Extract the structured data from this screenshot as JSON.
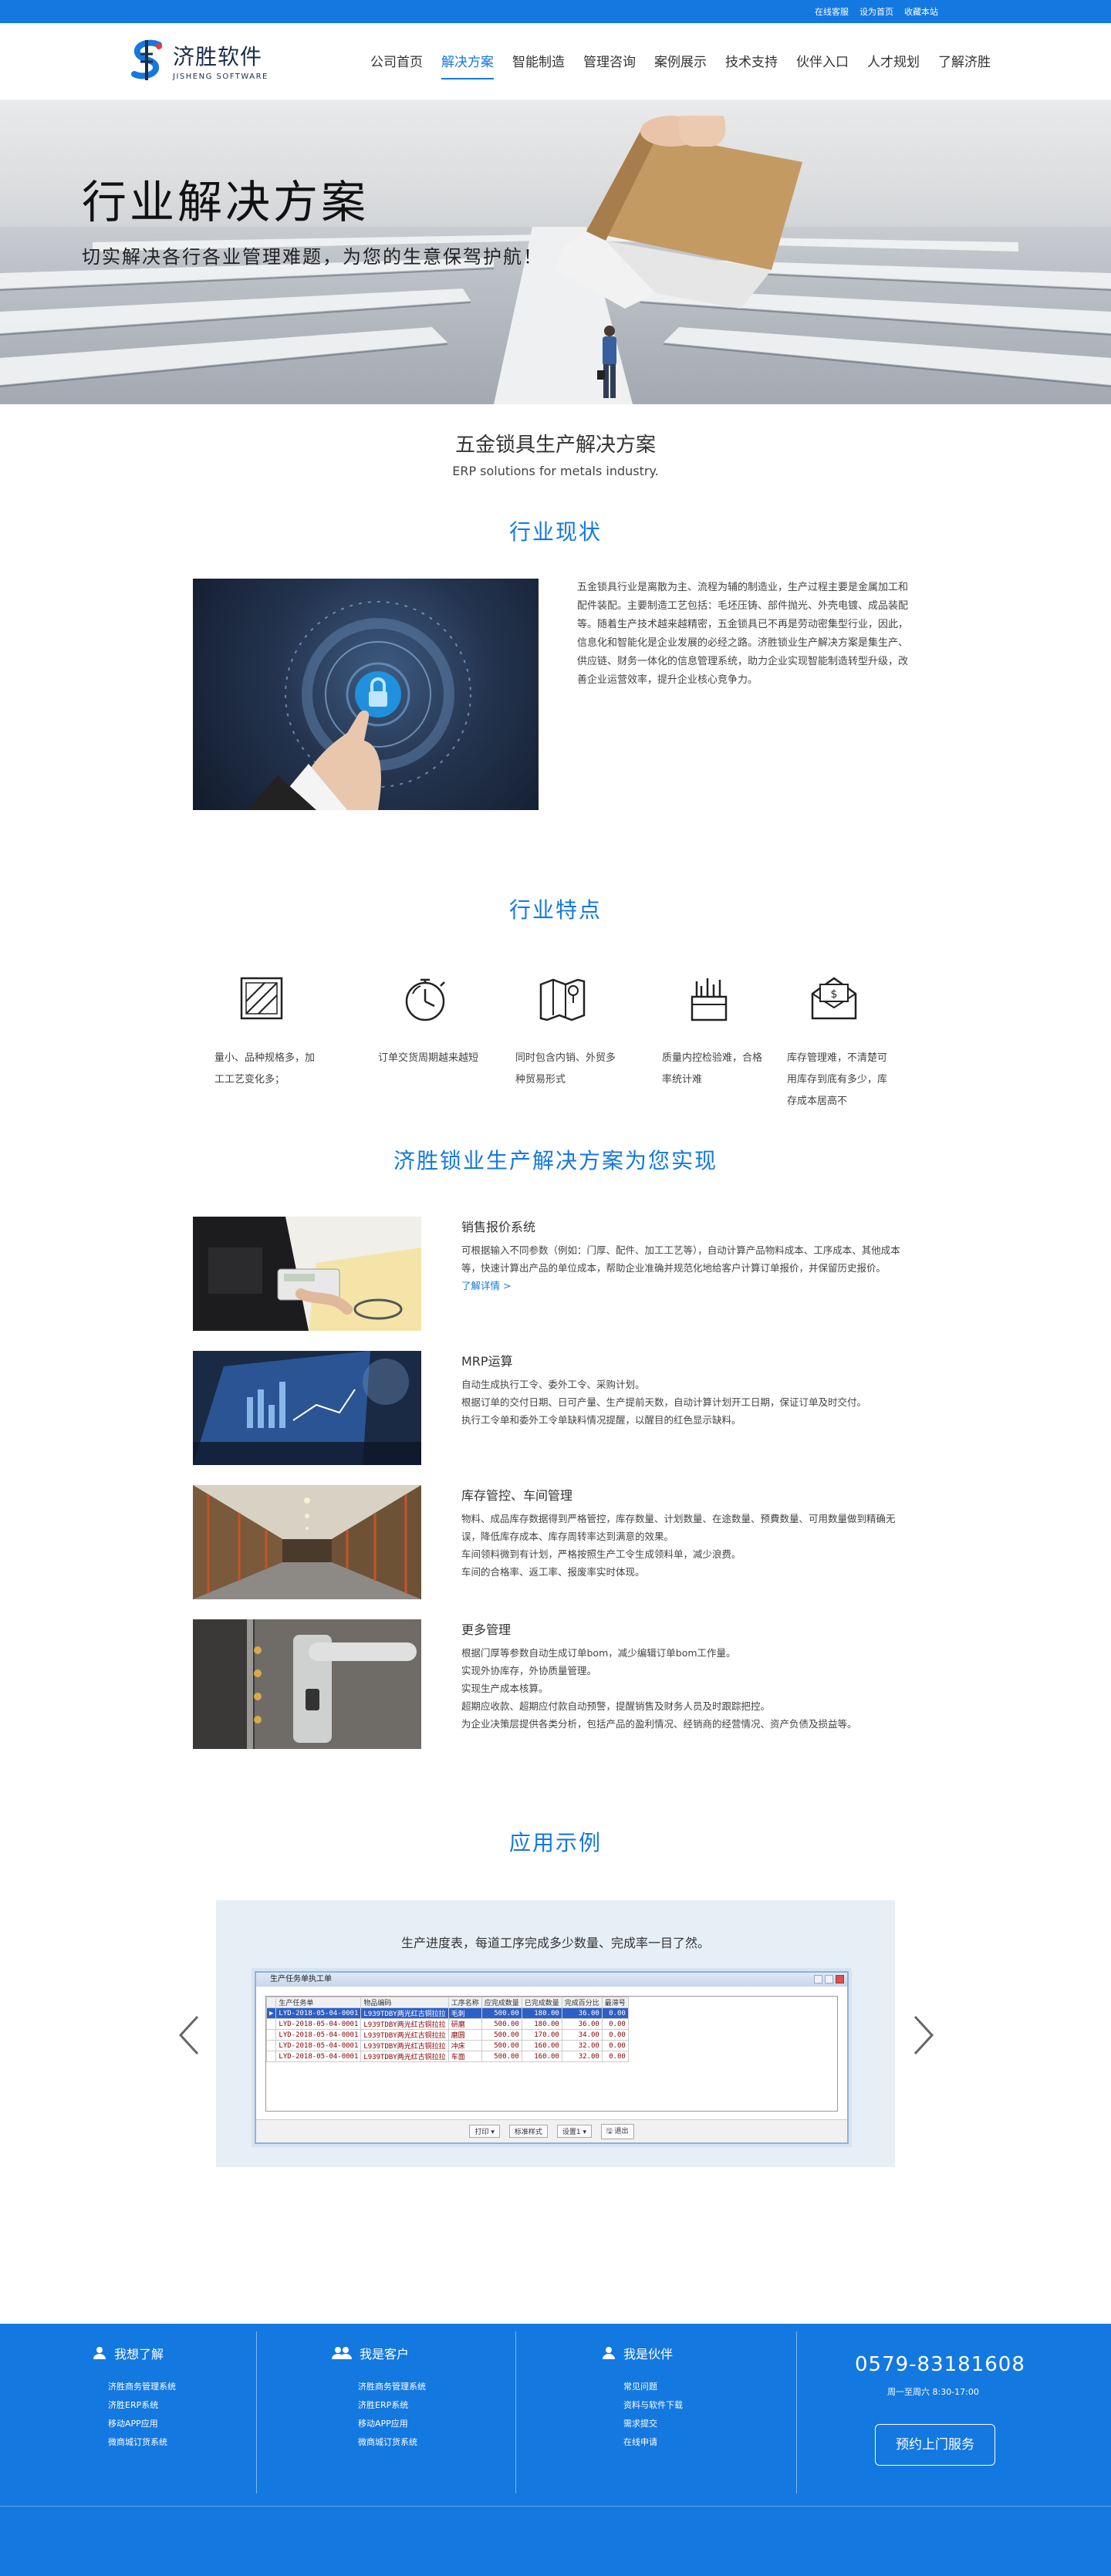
{
  "topbar": {
    "links": [
      "在线客服",
      "设为首页",
      "收藏本站"
    ]
  },
  "logo": {
    "cn": "济胜软件",
    "en": "JISHENG SOFTWARE"
  },
  "nav": [
    "公司首页",
    "解决方案",
    "智能制造",
    "管理咨询",
    "案例展示",
    "技术支持",
    "伙伴入口",
    "人才规划",
    "了解济胜"
  ],
  "banner": {
    "title": "行业解决方案",
    "subtitle": "切实解决各行各业管理难题，为您的生意保驾护航！"
  },
  "product": {
    "title": "五金锁具生产解决方案",
    "subtitle": "ERP solutions for metals industry."
  },
  "status": {
    "heading": "行业现状",
    "text": "五金锁具行业是离散为主、流程为辅的制造业，生产过程主要是金属加工和配件装配。主要制造工艺包括：毛坯压铸、部件抛光、外壳电镀、成品装配等。随着生产技术越来越精密，五金锁具已不再是劳动密集型行业，因此，信息化和智能化是企业发展的必经之路。济胜锁业生产解决方案是集生产、供应链、财务一体化的信息管理系统，助力企业实现智能制造转型升级，改善企业运营效率，提升企业核心竞争力。"
  },
  "features": {
    "heading": "行业特点",
    "items": [
      {
        "icon": "box-icon",
        "text": "量小、品种规格多，加工工艺变化多；"
      },
      {
        "icon": "stopwatch-icon",
        "text": "订单交货周期越来越短"
      },
      {
        "icon": "map-icon",
        "text": "同时包含内销、外贸多种贸易形式"
      },
      {
        "icon": "toolbox-icon",
        "text": "质量内控检验难，合格率统计难"
      },
      {
        "icon": "money-mail-icon",
        "text": "库存管理难，不清楚可用库存到底有多少，库存成本居高不"
      }
    ]
  },
  "solutions": {
    "heading": "济胜锁业生产解决方案为您实现",
    "items": [
      {
        "title": "销售报价系统",
        "lines": [
          "可根据输入不同参数（例如：门厚、配件、加工工艺等），自动计算产品物料成本、工序成本、其他成本等，快速计算出产品的单位成本，帮助企业准确并规范化地给客户计算订单报价，并保留历史报价。"
        ],
        "more": "了解详情 >"
      },
      {
        "title": "MRP运算",
        "lines": [
          "自动生成执行工令、委外工令、采购计划。",
          "根据订单的交付日期、日可产量、生产提前天数，自动计算计划开工日期，保证订单及时交付。",
          "执行工令单和委外工令单缺料情况提醒，以醒目的红色显示缺料。"
        ]
      },
      {
        "title": "库存管控、车间管理",
        "lines": [
          "物料、成品库存数据得到严格管控，库存数量、计划数量、在途数量、预費数量、可用数量做到精确无误，降低库存成本、库存周转率达到满意的效果。",
          "车间领料微到有计划，严格按照生产工令生成领料单，减少浪费。",
          "车间的合格率、返工率、报废率实时体现。"
        ]
      },
      {
        "title": "更多管理",
        "lines": [
          "根据门厚等参数自动生成订单bom，减少编辑订单bom工作量。",
          "实现外协库存，外协质量管理。",
          "实现生产成本核算。",
          "超期应收款、超期应付款自动预警，提醒销售及财务人员及时跟踪把控。",
          "为企业决策层提供各类分析，包括产品的盈利情况、经销商的经营情况、资产负债及损益等。"
        ]
      }
    ]
  },
  "example": {
    "heading": "应用示例",
    "caption": "生产进度表，每道工序完成多少数量、完成率一目了然。",
    "window_title": "生产任务单执工单",
    "columns": [
      "生产任务单",
      "物品编码",
      "工序名称",
      "应完成数量",
      "已完成数量",
      "完成百分比",
      "最滞号"
    ],
    "rows": [
      [
        "LYD-2018-05-04-0001",
        "L939TDBY两光红古铜拉拉",
        "毛刺",
        "500.00",
        "180.00",
        "36.00",
        "0.00"
      ],
      [
        "LYD-2018-05-04-0001",
        "L939TDBY两光红古铜拉拉",
        "研磨",
        "500.00",
        "180.00",
        "36.00",
        "0.00"
      ],
      [
        "LYD-2018-05-04-0001",
        "L939TDBY两光红古铜拉拉",
        "磨圆",
        "500.00",
        "170.00",
        "34.00",
        "0.00"
      ],
      [
        "LYD-2018-05-04-0001",
        "L939TDBY两光红古铜拉拉",
        "冲床",
        "500.00",
        "160.00",
        "32.00",
        "0.00"
      ],
      [
        "LYD-2018-05-04-0001",
        "L939TDBY两光红古铜拉拉",
        "车面",
        "500.00",
        "160.00",
        "32.00",
        "0.00"
      ]
    ],
    "footer_buttons": [
      "打印 ▾",
      "标准样式",
      "设置1 ▾",
      "🖫 退出"
    ]
  },
  "footer": {
    "col1": {
      "heading": "我想了解",
      "items": [
        "济胜商务管理系统",
        "济胜ERP系统",
        "移动APP应用",
        "微商城订货系统"
      ]
    },
    "col2": {
      "heading": "我是客户",
      "items": [
        "济胜商务管理系统",
        "济胜ERP系统",
        "移动APP应用",
        "微商城订货系统"
      ]
    },
    "col3": {
      "heading": "我是伙伴",
      "items": [
        "常见问题",
        "资料与软件下载",
        "需求提交",
        "在线申请"
      ]
    },
    "phone": "0579-83181608",
    "hours": "周一至周六 8:30-17:00",
    "book": "预约上门服务"
  },
  "colors": {
    "brand": "#1478e1",
    "text": "#333333"
  }
}
